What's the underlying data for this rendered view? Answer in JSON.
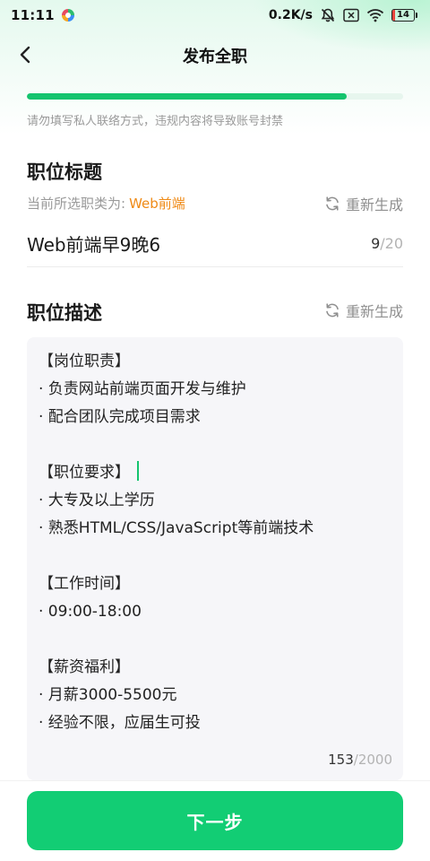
{
  "status_bar": {
    "time": "11:11",
    "network_speed": "0.2K/s",
    "battery_level": "14",
    "battery_fraction": 0.14,
    "icons": [
      "app-icon",
      "bell-muted-icon",
      "close-box-icon",
      "wifi-icon",
      "battery-icon"
    ]
  },
  "nav": {
    "title": "发布全职",
    "back_icon": "back-arrow-icon"
  },
  "progress": {
    "fraction": 0.85,
    "color": "#15c46e"
  },
  "warning_text": "请勿填写私人联络方式，违规内容将导致账号封禁",
  "job_title_section": {
    "heading": "职位标题",
    "category_label": "当前所选职类为:",
    "category_value": "Web前端",
    "regenerate_label": "重新生成",
    "value": "Web前端早9晚6",
    "count": "9",
    "max": "/20"
  },
  "job_desc_section": {
    "heading": "职位描述",
    "regenerate_label": "重新生成",
    "lines": [
      "【岗位职责】",
      "· 负责网站前端页面开发与维护",
      "· 配合团队完成项目需求",
      "",
      "【职位要求】",
      "· 大专及以上学历",
      "· 熟悉HTML/CSS/JavaScript等前端技术",
      "",
      "【工作时间】",
      "· 09:00-18:00",
      "",
      "【薪资福利】",
      "· 月薪3000-5500元",
      "· 经验不限，应届生可投"
    ],
    "count": "153",
    "max": "/2000"
  },
  "next_button": {
    "label": "下一步",
    "color": "#12cd74"
  },
  "colors": {
    "accent": "#15c46e",
    "category": "#ef8a16",
    "muted": "#9a9a9a"
  }
}
